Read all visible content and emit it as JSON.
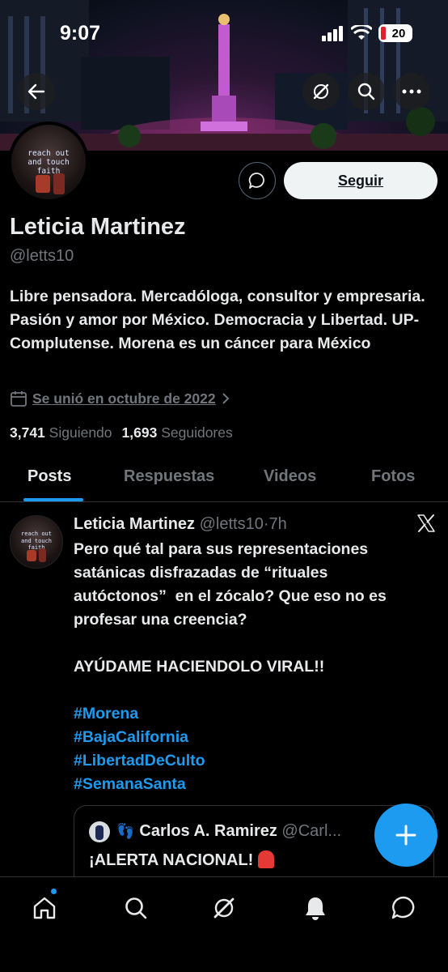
{
  "status_bar": {
    "time": "9:07",
    "battery": "20"
  },
  "profile": {
    "name": "Leticia Martinez",
    "handle": "@letts10",
    "avatar_text": "reach out\nand touch\nfaith",
    "bio": "Libre pensadora. Mercadóloga, consultor y empresaria. Pasión y amor por México. Democracia y Libertad. UP-Complutense. Morena es un cáncer para México",
    "joined": "Se unió en octubre de 2022",
    "following_count": "3,741",
    "following_label": "Siguiendo",
    "followers_count": "1,693",
    "followers_label": "Seguidores",
    "follow_label": "Seguir"
  },
  "tabs": [
    {
      "label": "Posts",
      "active": true
    },
    {
      "label": "Respuestas",
      "active": false
    },
    {
      "label": "Videos",
      "active": false
    },
    {
      "label": "Fotos",
      "active": false
    }
  ],
  "post": {
    "author": "Leticia Martinez",
    "handle": "@letts10",
    "time": "7h",
    "text_lines": [
      "Pero qué tal para sus representaciones",
      "satánicas disfrazadas de “rituales",
      "autóctonos”  en el zócalo? Que eso no es",
      "profesar una creencia?",
      "",
      "AYÚDAME HACIENDOLO VIRAL!!"
    ],
    "hashtags": [
      "#Morena",
      "#BajaCalifornia",
      "#LibertadDeCulto",
      "#SemanaSanta"
    ],
    "quote": {
      "author": "Carlos A. Ramirez",
      "handle": "@Carl...",
      "text": "¡ALERTA NACIONAL!"
    }
  },
  "icons": {
    "back": "arrow-left-icon",
    "grok": "grok-icon",
    "search": "search-icon",
    "more": "more-icon",
    "message": "message-icon",
    "calendar": "calendar-icon",
    "compose": "plus-icon",
    "nav": [
      "home-icon",
      "search-icon",
      "grok-icon",
      "bell-icon",
      "messages-icon"
    ]
  },
  "colors": {
    "accent": "#1d9bf0",
    "background": "#000000",
    "text": "#e7e9ea",
    "muted": "#71767b"
  }
}
